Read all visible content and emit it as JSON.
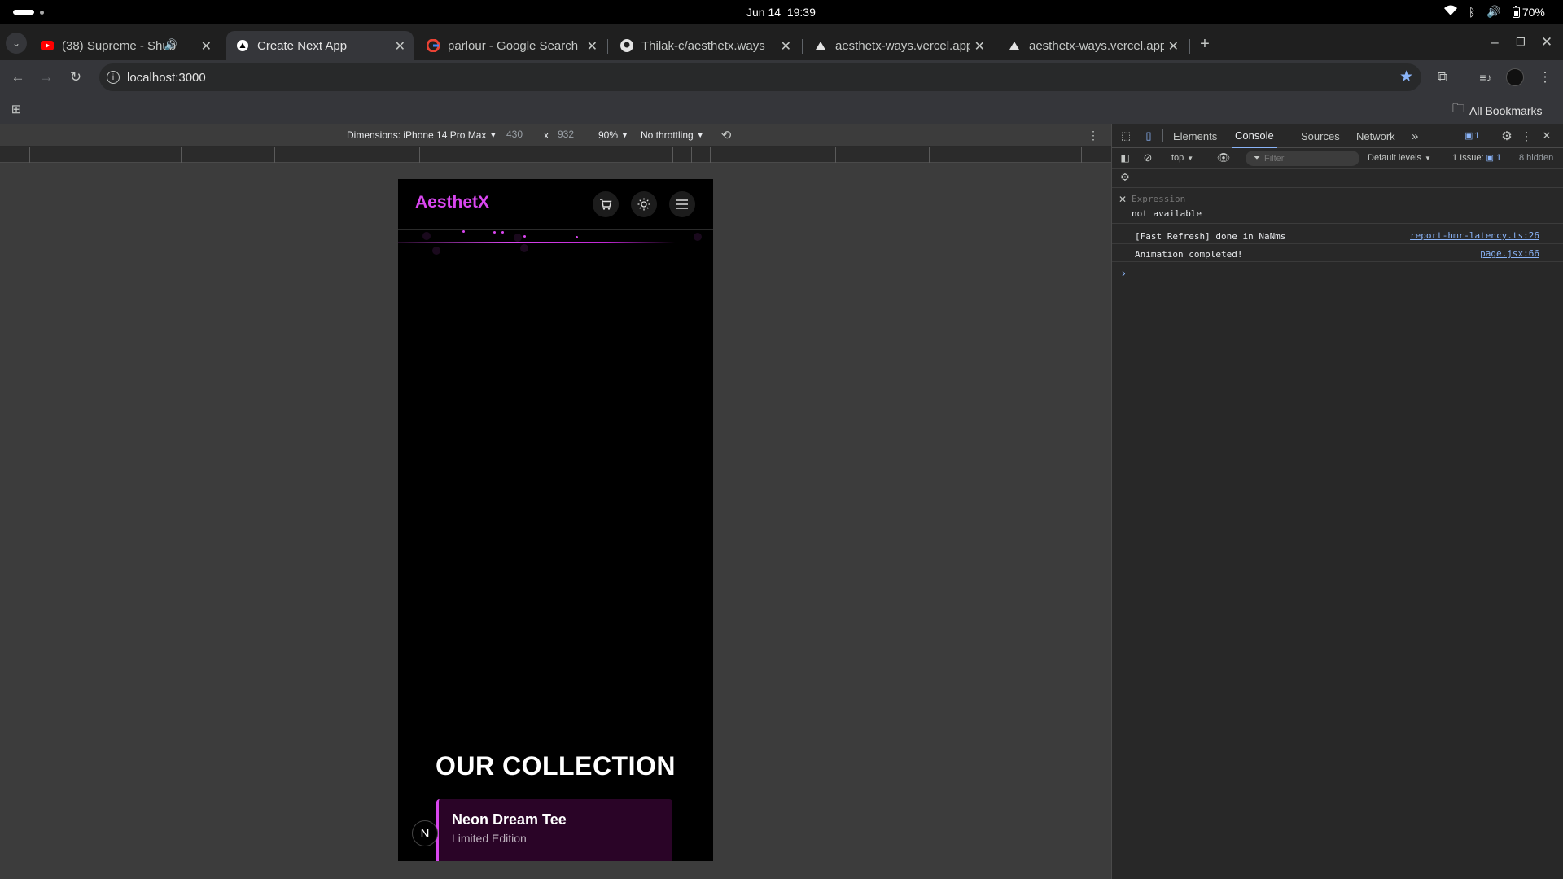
{
  "os": {
    "date": "Jun 14",
    "time": "19:39",
    "battery": "70%"
  },
  "tabs": [
    {
      "title": "(38) Supreme - Shubh",
      "favicon": "youtube-icon"
    },
    {
      "title": "Create Next App",
      "favicon": "vercel-icon",
      "active": true
    },
    {
      "title": "parlour - Google Search",
      "favicon": "google-icon"
    },
    {
      "title": "Thilak-c/aesthetx.ways",
      "favicon": "github-icon"
    },
    {
      "title": "aesthetx-ways.vercel.app",
      "favicon": "vercel-icon"
    },
    {
      "title": "aesthetx-ways.vercel.app",
      "favicon": "vercel-icon"
    }
  ],
  "toolbar": {
    "url": "localhost:3000"
  },
  "bookmarks": {
    "all_label": "All Bookmarks"
  },
  "device_toolbar": {
    "dimensions_label": "Dimensions: iPhone 14 Pro Max",
    "width": "430",
    "times": "x",
    "height": "932",
    "zoom": "90%",
    "throttling": "No throttling"
  },
  "app": {
    "brand": "AesthetX",
    "collection_title": "OUR COLLECTION",
    "product_name": "Neon Dream Tee",
    "product_subtitle": "Limited Edition",
    "next_badge": "N",
    "accent": "#d946ef"
  },
  "devtools": {
    "tabs": [
      "Elements",
      "Console",
      "Sources",
      "Network"
    ],
    "active_tab": "Console",
    "issues_badge": "1",
    "context": "top",
    "filter_placeholder": "Filter",
    "levels": "Default levels",
    "issues_label": "1 Issue:",
    "issues_count": "1",
    "hidden": "8 hidden",
    "expression_placeholder": "Expression",
    "expression_value": "not available",
    "messages": [
      {
        "text": "[Fast Refresh] done in NaNms",
        "source": "report-hmr-latency.ts:26"
      },
      {
        "text": "Animation completed!",
        "source": "page.jsx:66"
      }
    ],
    "prompt": "›"
  }
}
